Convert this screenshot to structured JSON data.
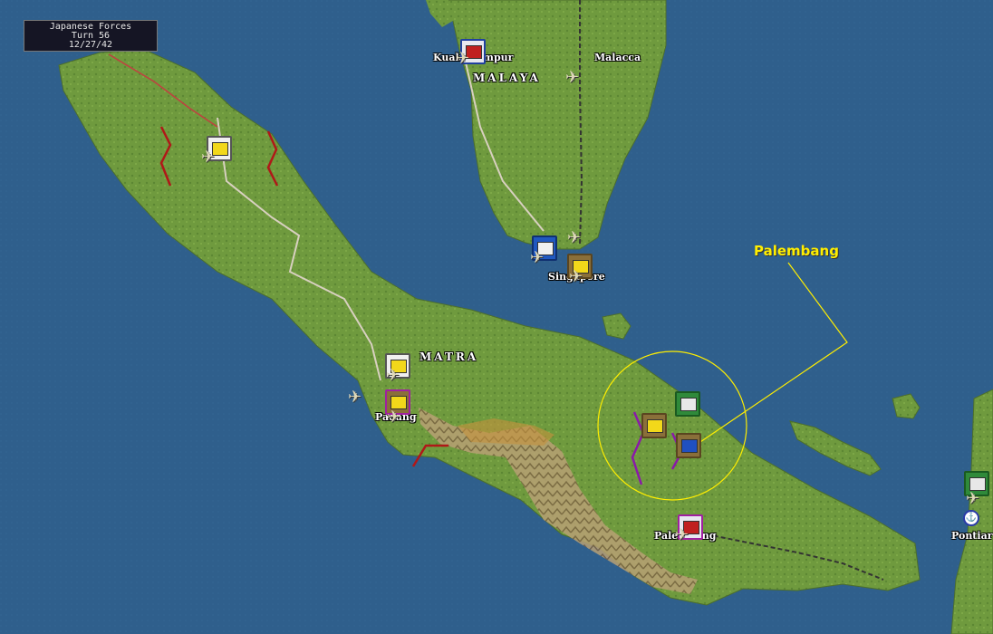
{
  "status": {
    "faction": "Japanese Forces",
    "turn": "Turn 56",
    "date": "12/27/42"
  },
  "place_labels": {
    "kuala_lumpur": "Kuala Lumpur",
    "malacca": "Malacca",
    "malaya": "MALAYA",
    "singapore": "Singapore",
    "sumatra": "MATRA",
    "padang": "Padang",
    "palembang": "Palembang",
    "pontianak": "Pontiar"
  },
  "callout": {
    "label": "Palembang"
  },
  "icons": {
    "airfield": "airplane-icon",
    "port": "anchor-icon"
  },
  "colors": {
    "sea": "#2f5f8c",
    "land": "#6f9a3e",
    "callout": "#ffee00",
    "front_line": "#b01818"
  }
}
